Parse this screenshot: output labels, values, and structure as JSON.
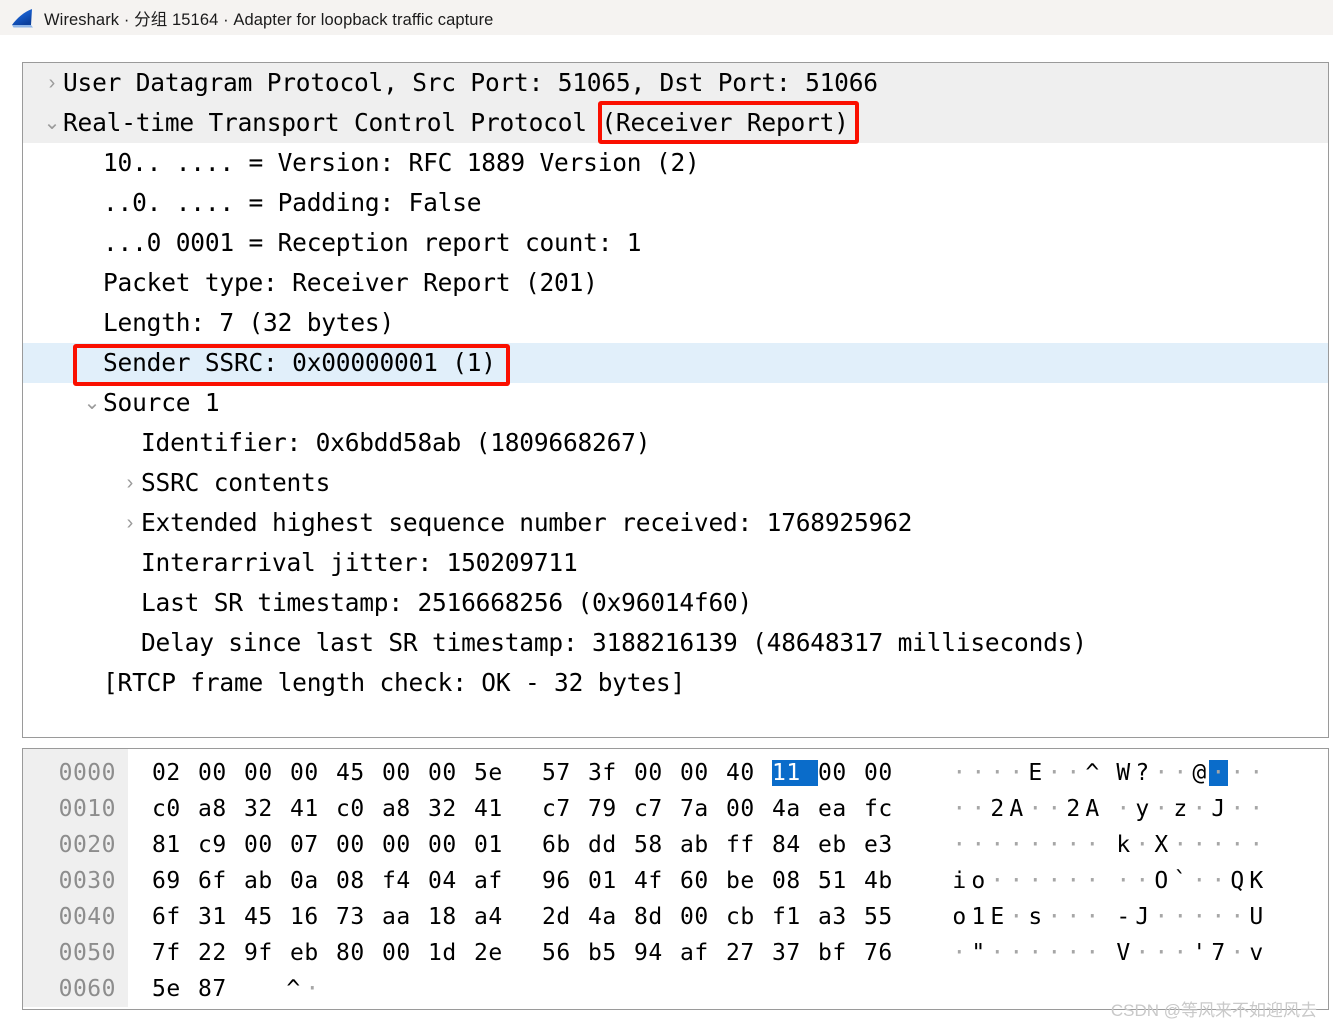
{
  "window": {
    "title": "Wireshark · 分组 15164 · Adapter for loopback traffic capture",
    "logo_icon": "wireshark-shark-fin-icon"
  },
  "colors": {
    "titlebar_bg": "#f5f3f1",
    "row_shaded_bg": "#efefef",
    "row_selected_bg": "#e1effa",
    "annotation_red": "#fa0f00",
    "hex_selection_blue": "#0a6cca",
    "offset_text": "#8d8d8d",
    "ascii_dot": "#a6a6a6",
    "watermark": "#c9c9c9"
  },
  "details": {
    "rows": [
      {
        "twig": "›",
        "indent": 0,
        "text": "User Datagram Protocol, Src Port: 51065, Dst Port: 51066",
        "shaded": true,
        "selected": false
      },
      {
        "twig": "⌄",
        "indent": 0,
        "text": "Real-time Transport Control Protocol (Receiver Report)",
        "shaded": true,
        "selected": false
      },
      {
        "twig": "",
        "indent": 1,
        "text": "10.. .... = Version: RFC 1889 Version (2)",
        "shaded": false,
        "selected": false
      },
      {
        "twig": "",
        "indent": 1,
        "text": "..0. .... = Padding: False",
        "shaded": false,
        "selected": false
      },
      {
        "twig": "",
        "indent": 1,
        "text": "...0 0001 = Reception report count: 1",
        "shaded": false,
        "selected": false
      },
      {
        "twig": "",
        "indent": 1,
        "text": "Packet type: Receiver Report (201)",
        "shaded": false,
        "selected": false
      },
      {
        "twig": "",
        "indent": 1,
        "text": "Length: 7 (32 bytes)",
        "shaded": false,
        "selected": false
      },
      {
        "twig": "",
        "indent": 1,
        "text": "Sender SSRC: 0x00000001 (1)",
        "shaded": false,
        "selected": true
      },
      {
        "twig": "⌄",
        "indent": 1,
        "text": "Source 1",
        "shaded": false,
        "selected": false
      },
      {
        "twig": "",
        "indent": 2,
        "text": "Identifier: 0x6bdd58ab (1809668267)",
        "shaded": false,
        "selected": false
      },
      {
        "twig": "›",
        "indent": 2,
        "text": "SSRC contents",
        "shaded": false,
        "selected": false
      },
      {
        "twig": "›",
        "indent": 2,
        "text": "Extended highest sequence number received: 1768925962",
        "shaded": false,
        "selected": false
      },
      {
        "twig": "",
        "indent": 2,
        "text": "Interarrival jitter: 150209711",
        "shaded": false,
        "selected": false
      },
      {
        "twig": "",
        "indent": 2,
        "text": "Last SR timestamp: 2516668256 (0x96014f60)",
        "shaded": false,
        "selected": false
      },
      {
        "twig": "",
        "indent": 2,
        "text": "Delay since last SR timestamp: 3188216139 (48648317 milliseconds)",
        "shaded": false,
        "selected": false
      },
      {
        "twig": "",
        "indent": 1,
        "text": "[RTCP frame length check: OK - 32 bytes]",
        "shaded": false,
        "selected": false
      }
    ]
  },
  "annotations": [
    {
      "name": "redbox-receiver-report",
      "target": "(Receiver Report)"
    },
    {
      "name": "redbox-sender-ssrc",
      "target": "Sender SSRC: 0x00000001 (1)"
    }
  ],
  "bytes_pane": {
    "rows": [
      {
        "offset": "0000",
        "hex": [
          "02",
          "00",
          "00",
          "00",
          "45",
          "00",
          "00",
          "5e",
          "57",
          "3f",
          "00",
          "00",
          "40",
          "11",
          "00",
          "00"
        ],
        "ascii": [
          ".",
          ".",
          ".",
          ".",
          "E",
          ".",
          ".",
          "^",
          "W",
          "?",
          ".",
          ".",
          "@",
          ".",
          ".",
          "."
        ],
        "selected_indices": [
          13
        ]
      },
      {
        "offset": "0010",
        "hex": [
          "c0",
          "a8",
          "32",
          "41",
          "c0",
          "a8",
          "32",
          "41",
          "c7",
          "79",
          "c7",
          "7a",
          "00",
          "4a",
          "ea",
          "fc"
        ],
        "ascii": [
          ".",
          ".",
          "2",
          "A",
          ".",
          ".",
          "2",
          "A",
          ".",
          "y",
          ".",
          "z",
          ".",
          "J",
          ".",
          "."
        ],
        "selected_indices": []
      },
      {
        "offset": "0020",
        "hex": [
          "81",
          "c9",
          "00",
          "07",
          "00",
          "00",
          "00",
          "01",
          "6b",
          "dd",
          "58",
          "ab",
          "ff",
          "84",
          "eb",
          "e3"
        ],
        "ascii": [
          ".",
          ".",
          ".",
          ".",
          ".",
          ".",
          ".",
          ".",
          "k",
          ".",
          "X",
          ".",
          ".",
          ".",
          ".",
          "."
        ],
        "selected_indices": []
      },
      {
        "offset": "0030",
        "hex": [
          "69",
          "6f",
          "ab",
          "0a",
          "08",
          "f4",
          "04",
          "af",
          "96",
          "01",
          "4f",
          "60",
          "be",
          "08",
          "51",
          "4b"
        ],
        "ascii": [
          "i",
          "o",
          ".",
          ".",
          ".",
          ".",
          ".",
          ".",
          ".",
          ".",
          "O",
          "`",
          ".",
          ".",
          "Q",
          "K"
        ],
        "selected_indices": []
      },
      {
        "offset": "0040",
        "hex": [
          "6f",
          "31",
          "45",
          "16",
          "73",
          "aa",
          "18",
          "a4",
          "2d",
          "4a",
          "8d",
          "00",
          "cb",
          "f1",
          "a3",
          "55"
        ],
        "ascii": [
          "o",
          "1",
          "E",
          ".",
          "s",
          ".",
          ".",
          ".",
          "-",
          "J",
          ".",
          ".",
          ".",
          ".",
          ".",
          "U"
        ],
        "selected_indices": []
      },
      {
        "offset": "0050",
        "hex": [
          "7f",
          "22",
          "9f",
          "eb",
          "80",
          "00",
          "1d",
          "2e",
          "56",
          "b5",
          "94",
          "af",
          "27",
          "37",
          "bf",
          "76"
        ],
        "ascii": [
          ".",
          "\"",
          ".",
          ".",
          ".",
          ".",
          ".",
          ".",
          "V",
          ".",
          ".",
          ".",
          "'",
          "7",
          ".",
          "v"
        ],
        "selected_indices": []
      },
      {
        "offset": "0060",
        "hex": [
          "5e",
          "87"
        ],
        "ascii": [
          "^",
          "."
        ],
        "selected_indices": []
      }
    ]
  },
  "watermark": {
    "text": "CSDN @等风来不如迎风去"
  }
}
